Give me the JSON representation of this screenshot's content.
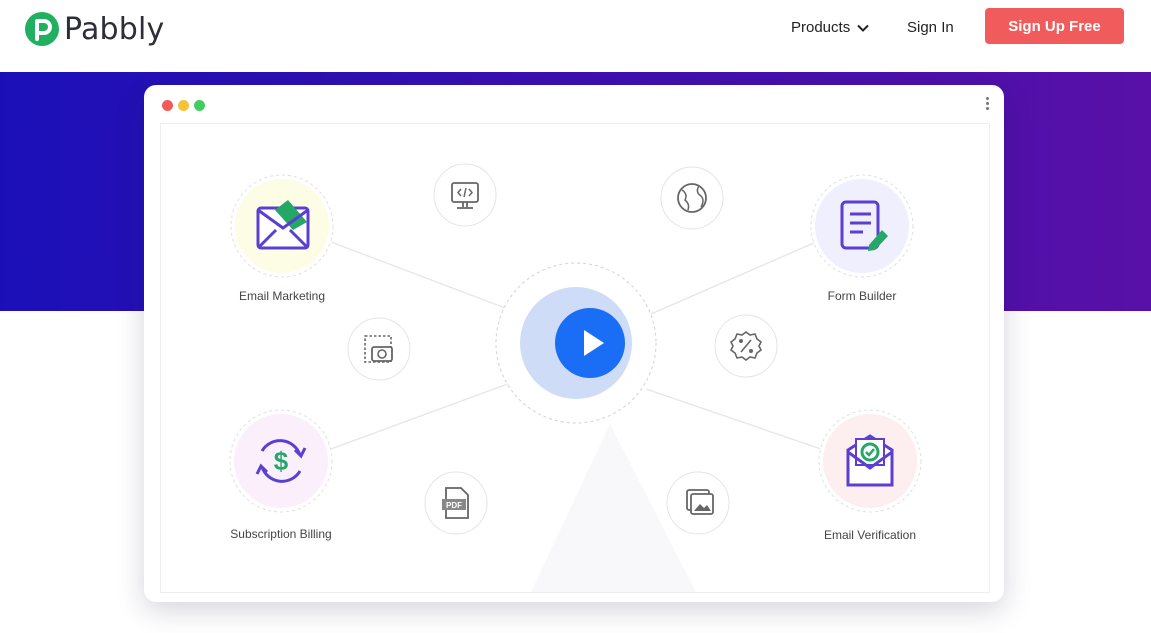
{
  "header": {
    "brand": "Pabbly",
    "nav_products": "Products",
    "nav_signin": "Sign In",
    "signup": "Sign Up Free"
  },
  "colors": {
    "accent": "#f25b5b",
    "hero_gradient_start": "#1b10b8",
    "hero_gradient_end": "#5810a8",
    "play_button": "#1a6ef5",
    "logo_green": "#20b060"
  },
  "window_controls": [
    "close",
    "minimize",
    "maximize"
  ],
  "features": [
    {
      "label": "Email Marketing",
      "icon": "envelope-icon",
      "bg": "#fdfde6"
    },
    {
      "label": "Form Builder",
      "icon": "form-icon",
      "bg": "#efeffd"
    },
    {
      "label": "Subscription Billing",
      "icon": "dollar-cycle-icon",
      "bg": "#fbeffc"
    },
    {
      "label": "Email Verification",
      "icon": "mail-check-icon",
      "bg": "#fdeef0"
    }
  ],
  "small_icons": [
    "code-monitor-icon",
    "globe-icon",
    "screenshot-icon",
    "percent-badge-icon",
    "pdf-icon",
    "gallery-icon"
  ],
  "play": {
    "icon": "play-icon"
  }
}
